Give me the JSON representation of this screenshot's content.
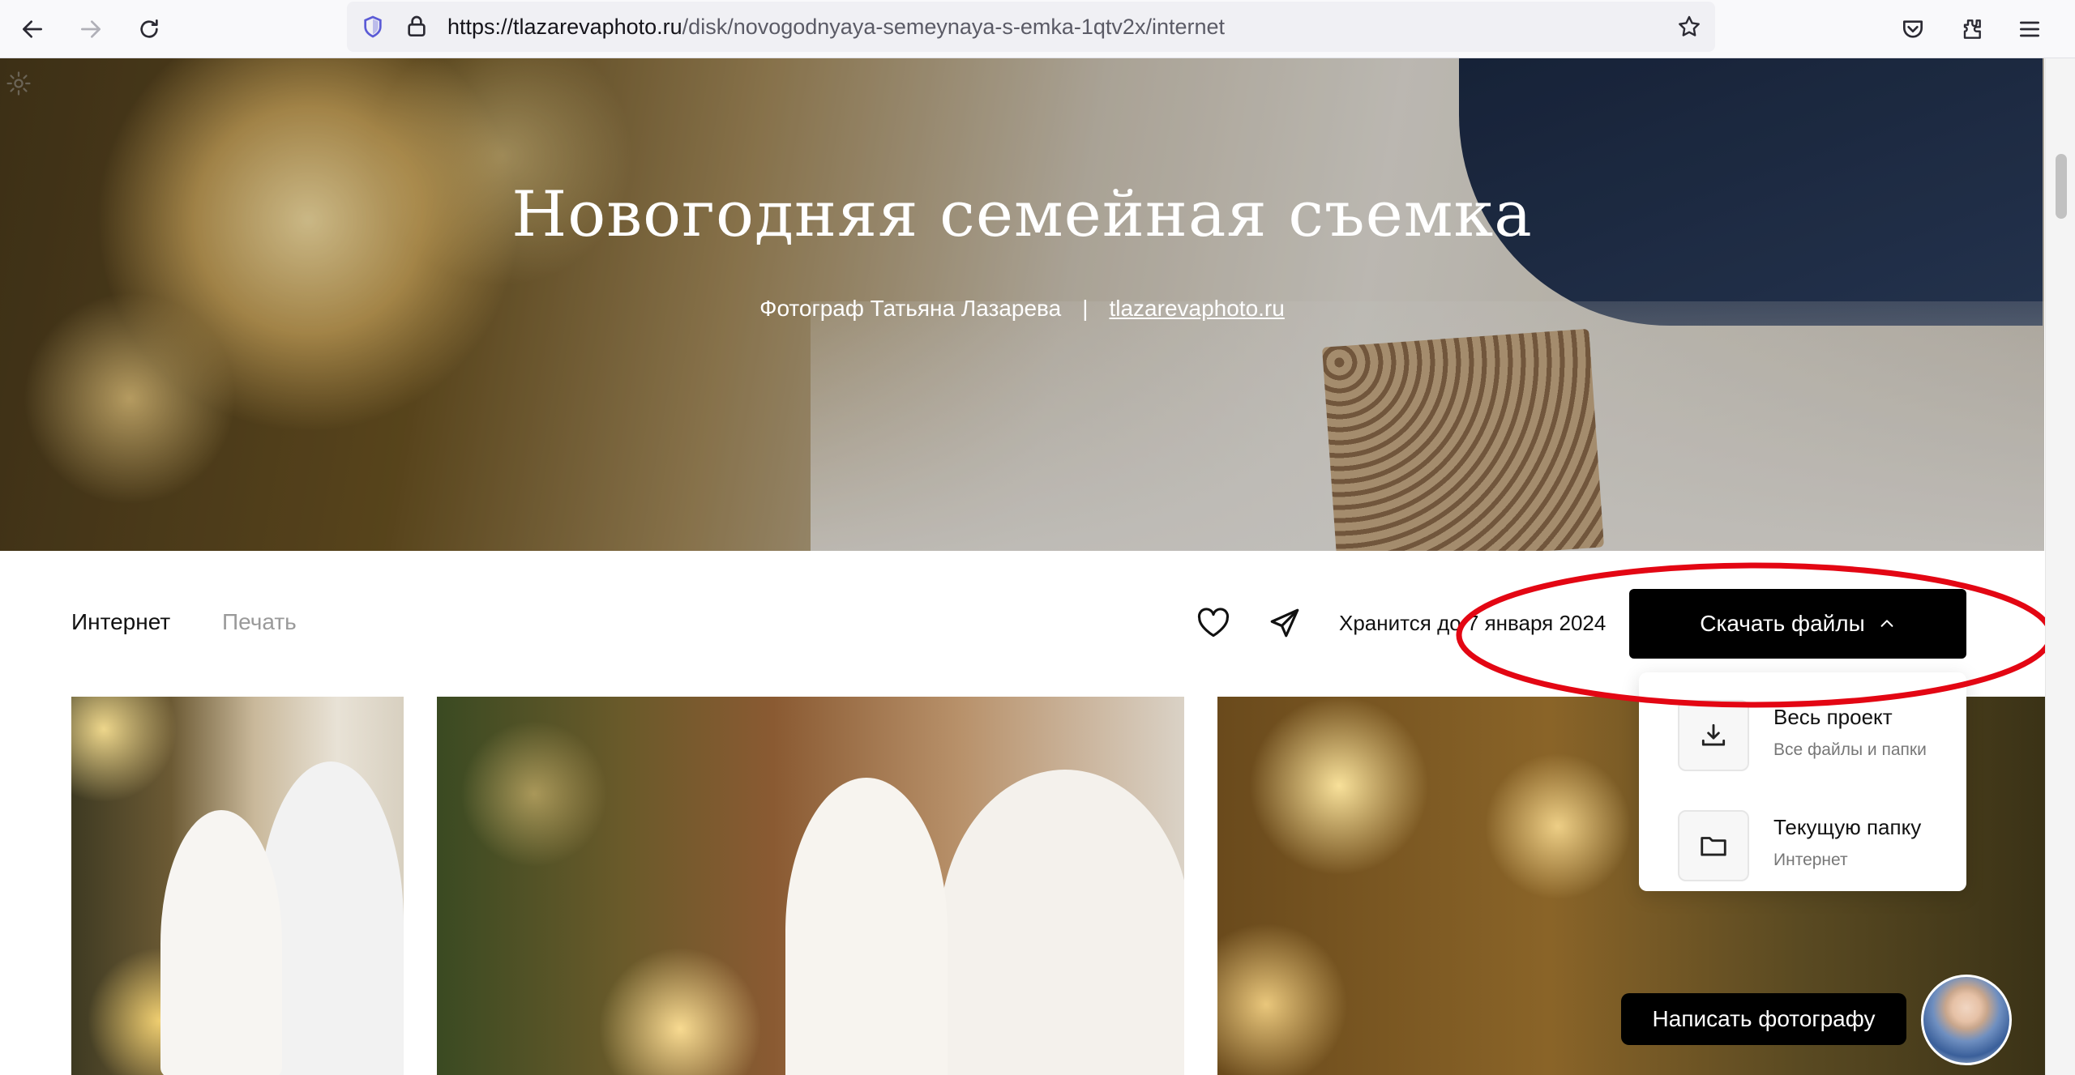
{
  "browser": {
    "url_domain": "https://tlazarevaphoto.ru",
    "url_path": "/disk/novogodnyaya-semeynaya-s-emka-1qtv2x/internet"
  },
  "hero": {
    "title": "Новогодняя семейная съемка",
    "photographer": "Фотограф Татьяна Лазарева",
    "separator": "|",
    "site_link": "tlazarevaphoto.ru"
  },
  "tabs": [
    {
      "label": "Интернет",
      "active": true
    },
    {
      "label": "Печать",
      "active": false
    }
  ],
  "stored_until": "Хранится до 7 января 2024",
  "download_button": {
    "label": "Скачать файлы"
  },
  "dropdown": {
    "items": [
      {
        "title": "Весь проект",
        "subtitle": "Все файлы и папки",
        "icon": "download-icon"
      },
      {
        "title": "Текущую папку",
        "subtitle": "Интернет",
        "icon": "folder-icon"
      }
    ]
  },
  "chat": {
    "label": "Написать фотографу"
  },
  "colors": {
    "annotation": "#e30613",
    "button": "#000000",
    "muted_tab": "#9a9a9a"
  }
}
